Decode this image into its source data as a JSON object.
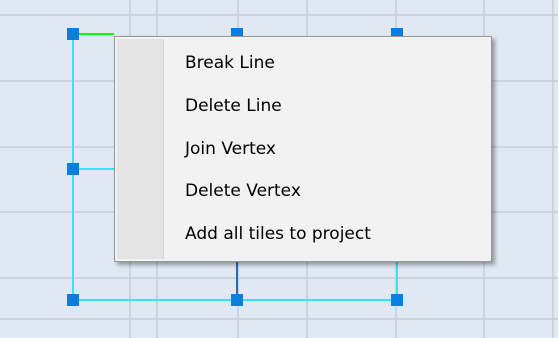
{
  "colors": {
    "canvas_background": "#dfe8f3",
    "grid_line": "#c4ccd7",
    "selection_line": "#34e6f4",
    "green_line": "#00ff00",
    "handle_fill": "#0a7ee0",
    "menu_background": "#f2f2f2"
  },
  "context_menu": {
    "items": [
      {
        "label": "Break Line"
      },
      {
        "label": "Delete Line"
      },
      {
        "label": "Join Vertex"
      },
      {
        "label": "Delete Vertex"
      },
      {
        "label": "Add all tiles to project"
      }
    ]
  }
}
